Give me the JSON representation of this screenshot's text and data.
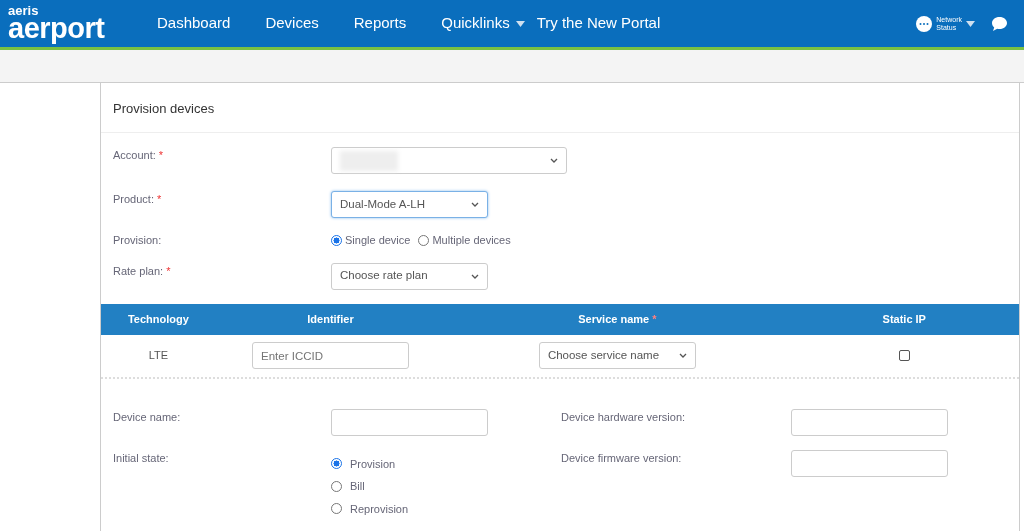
{
  "brand": {
    "small": "aeris",
    "large": "aerport"
  },
  "nav": [
    {
      "label": "Dashboard",
      "dropdown": false
    },
    {
      "label": "Devices",
      "dropdown": false
    },
    {
      "label": "Reports",
      "dropdown": false
    },
    {
      "label": "Quicklinks",
      "dropdown": true
    },
    {
      "label": "Try the New Portal",
      "dropdown": false
    }
  ],
  "network_status": {
    "line1": "Network",
    "line2": "Status"
  },
  "page_title": "Provision devices",
  "account": {
    "label": "Account:",
    "required_mark": "*",
    "redacted": true
  },
  "product": {
    "label": "Product:",
    "required_mark": "*",
    "value": "Dual-Mode A-LH",
    "focused": true
  },
  "provision": {
    "label": "Provision:",
    "options": [
      {
        "label": "Single device",
        "selected": true
      },
      {
        "label": "Multiple devices",
        "selected": false
      }
    ]
  },
  "rate_plan": {
    "label": "Rate plan:",
    "required_mark": "*",
    "placeholder": "Choose rate plan"
  },
  "table": {
    "columns": [
      {
        "label": "Technology"
      },
      {
        "label": "Identifier"
      },
      {
        "label": "Service name",
        "required_mark": "*"
      },
      {
        "label": "Static IP"
      }
    ],
    "rows": [
      {
        "technology": "LTE",
        "identifier_placeholder": "Enter ICCID",
        "service_placeholder": "Choose service name",
        "static_ip": false
      }
    ]
  },
  "device_name": {
    "label": "Device name:"
  },
  "initial_state": {
    "label": "Initial state:",
    "options": [
      {
        "label": "Provision",
        "selected": true
      },
      {
        "label": "Bill",
        "selected": false
      },
      {
        "label": "Reprovision",
        "selected": false
      }
    ]
  },
  "hardware_version": {
    "label": "Device hardware version:"
  },
  "firmware_version": {
    "label": "Device firmware version:"
  }
}
